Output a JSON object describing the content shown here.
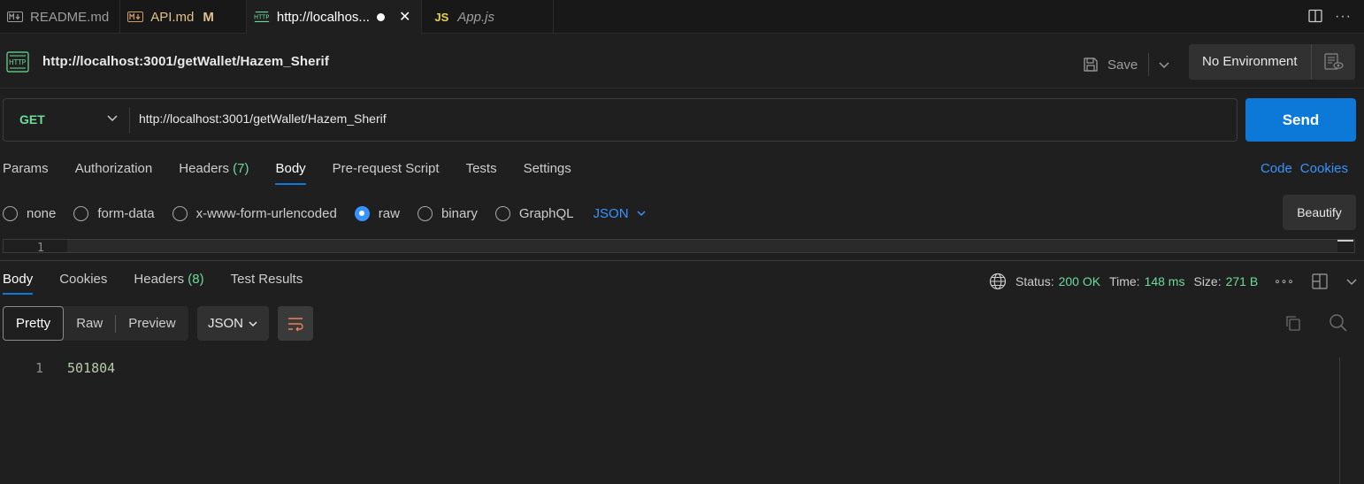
{
  "tabs": [
    {
      "label": "README.md",
      "icon": "markdown-icon"
    },
    {
      "label": "API.md",
      "modified": "M",
      "icon": "markdown-icon"
    },
    {
      "label": "http://localhos...",
      "icon": "http-icon",
      "active": true
    },
    {
      "label": "App.js",
      "icon_text": "JS"
    }
  ],
  "request": {
    "title": "http://localhost:3001/getWallet/Hazem_Sherif",
    "method": "GET",
    "url": "http://localhost:3001/getWallet/Hazem_Sherif",
    "save_label": "Save",
    "environment": "No Environment",
    "send_label": "Send"
  },
  "request_tabs": {
    "params": "Params",
    "authorization": "Authorization",
    "headers": "Headers",
    "headers_count": "(7)",
    "body": "Body",
    "prerequest": "Pre-request Script",
    "tests": "Tests",
    "settings": "Settings",
    "code": "Code",
    "cookies": "Cookies"
  },
  "body_types": {
    "none": "none",
    "form_data": "form-data",
    "urlencoded": "x-www-form-urlencoded",
    "raw": "raw",
    "binary": "binary",
    "graphql": "GraphQL",
    "format": "JSON",
    "beautify": "Beautify",
    "editor_line": "1"
  },
  "response_tabs": {
    "body": "Body",
    "cookies": "Cookies",
    "headers": "Headers",
    "headers_count": "(8)",
    "test_results": "Test Results"
  },
  "status": {
    "status_label": "Status:",
    "status_value": "200 OK",
    "time_label": "Time:",
    "time_value": "148 ms",
    "size_label": "Size:",
    "size_value": "271 B"
  },
  "response_view": {
    "pretty": "Pretty",
    "raw": "Raw",
    "preview": "Preview",
    "format": "JSON"
  },
  "response_body": {
    "line_number": "1",
    "content": "501804"
  },
  "colors": {
    "accent": "#0c78d8",
    "method": "#6bdd9a",
    "link": "#3794ff",
    "value": "#b5cea8"
  }
}
